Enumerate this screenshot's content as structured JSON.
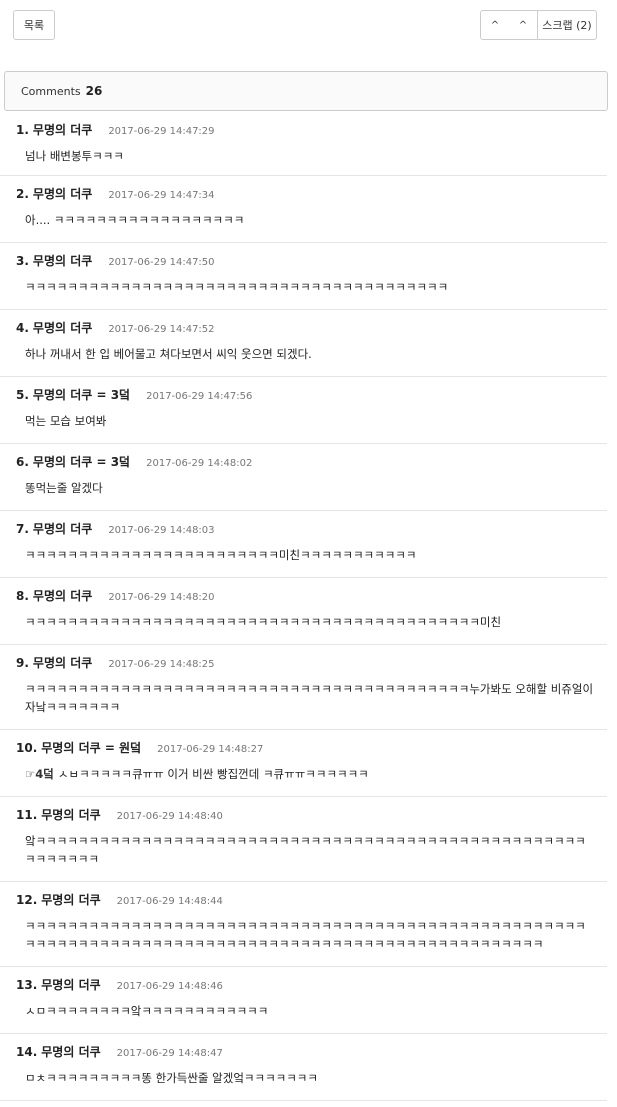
{
  "toolbar": {
    "list_label": "목록",
    "up_icon": "^",
    "down_icon": "^",
    "scrap_label": "스크랩 (2)"
  },
  "comments_header": {
    "label": "Comments",
    "count": "26"
  },
  "comments": [
    {
      "num": "1.",
      "author": "무명의 더쿠",
      "date": "2017-06-29 14:47:29",
      "body": "넘나 배변봉투ㅋㅋㅋ"
    },
    {
      "num": "2.",
      "author": "무명의 더쿠",
      "date": "2017-06-29 14:47:34",
      "body": "아.... ㅋㅋㅋㅋㅋㅋㅋㅋㅋㅋㅋㅋㅋㅋㅋㅋㅋㅋ"
    },
    {
      "num": "3.",
      "author": "무명의 더쿠",
      "date": "2017-06-29 14:47:50",
      "body": "ㅋㅋㅋㅋㅋㅋㅋㅋㅋㅋㅋㅋㅋㅋㅋㅋㅋㅋㅋㅋㅋㅋㅋㅋㅋㅋㅋㅋㅋㅋㅋㅋㅋㅋㅋㅋㅋㅋㅋㅋ"
    },
    {
      "num": "4.",
      "author": "무명의 더쿠",
      "date": "2017-06-29 14:47:52",
      "body": "하나 꺼내서 한 입 베어물고 쳐다보면서 씨익 웃으면 되겠다."
    },
    {
      "num": "5.",
      "author": "무명의 더쿠 = 3덬",
      "date": "2017-06-29 14:47:56",
      "body": "먹는 모습 보여봐"
    },
    {
      "num": "6.",
      "author": "무명의 더쿠 = 3덬",
      "date": "2017-06-29 14:48:02",
      "body": "똥먹는줄 알겠다"
    },
    {
      "num": "7.",
      "author": "무명의 더쿠",
      "date": "2017-06-29 14:48:03",
      "body": "ㅋㅋㅋㅋㅋㅋㅋㅋㅋㅋㅋㅋㅋㅋㅋㅋㅋㅋㅋㅋㅋㅋㅋㅋ미친ㅋㅋㅋㅋㅋㅋㅋㅋㅋㅋㅋ"
    },
    {
      "num": "8.",
      "author": "무명의 더쿠",
      "date": "2017-06-29 14:48:20",
      "body": "ㅋㅋㅋㅋㅋㅋㅋㅋㅋㅋㅋㅋㅋㅋㅋㅋㅋㅋㅋㅋㅋㅋㅋㅋㅋㅋㅋㅋㅋㅋㅋㅋㅋㅋㅋㅋㅋㅋㅋㅋㅋㅋㅋ미친"
    },
    {
      "num": "9.",
      "author": "무명의 더쿠",
      "date": "2017-06-29 14:48:25",
      "body": "ㅋㅋㅋㅋㅋㅋㅋㅋㅋㅋㅋㅋㅋㅋㅋㅋㅋㅋㅋㅋㅋㅋㅋㅋㅋㅋㅋㅋㅋㅋㅋㅋㅋㅋㅋㅋㅋㅋㅋㅋㅋㅋ누가봐도 오해할 비쥬얼이자낰ㅋㅋㅋㅋㅋㅋㅋ"
    },
    {
      "num": "10.",
      "author": "무명의 더쿠 = 원덬",
      "date": "2017-06-29 14:48:27",
      "icon": "☞4덬",
      "body": "ㅅㅂㅋㅋㅋㅋㅋ큐ㅠㅠ 이거 비싼 빵집껀데 ㅋ큐ㅠㅠㅋㅋㅋㅋㅋㅋ"
    },
    {
      "num": "11.",
      "author": "무명의 더쿠",
      "date": "2017-06-29 14:48:40",
      "body": "앜ㅋㅋㅋㅋㅋㅋㅋㅋㅋㅋㅋㅋㅋㅋㅋㅋㅋㅋㅋㅋㅋㅋㅋㅋㅋㅋㅋㅋㅋㅋㅋㅋㅋㅋㅋㅋㅋㅋㅋㅋㅋㅋㅋㅋㅋㅋㅋㅋㅋㅋㅋㅋㅋㅋㅋㅋㅋㅋㅋ"
    },
    {
      "num": "12.",
      "author": "무명의 더쿠",
      "date": "2017-06-29 14:48:44",
      "body": "ㅋㅋㅋㅋㅋㅋㅋㅋㅋㅋㅋㅋㅋㅋㅋㅋㅋㅋㅋㅋㅋㅋㅋㅋㅋㅋㅋㅋㅋㅋㅋㅋㅋㅋㅋㅋㅋㅋㅋㅋㅋㅋㅋㅋㅋㅋㅋㅋㅋㅋㅋㅋㅋㅋㅋㅋㅋㅋㅋㅋㅋㅋㅋㅋㅋㅋㅋㅋㅋㅋㅋㅋㅋㅋㅋㅋㅋㅋㅋㅋㅋㅋㅋㅋㅋㅋㅋㅋㅋㅋㅋㅋㅋㅋㅋㅋㅋㅋㅋㅋㅋㅋ"
    },
    {
      "num": "13.",
      "author": "무명의 더쿠",
      "date": "2017-06-29 14:48:46",
      "body": "ㅅㅁㅋㅋㅋㅋㅋㅋㅋㅋ앜ㅋㅋㅋㅋㅋㅋㅋㅋㅋㅋㅋㅋ"
    },
    {
      "num": "14.",
      "author": "무명의 더쿠",
      "date": "2017-06-29 14:48:47",
      "body": "ㅁㅊㅋㅋㅋㅋㅋㅋㅋㅋㅋ똥 한가득싼줄 알겠엌ㅋㅋㅋㅋㅋㅋㅋ"
    }
  ]
}
